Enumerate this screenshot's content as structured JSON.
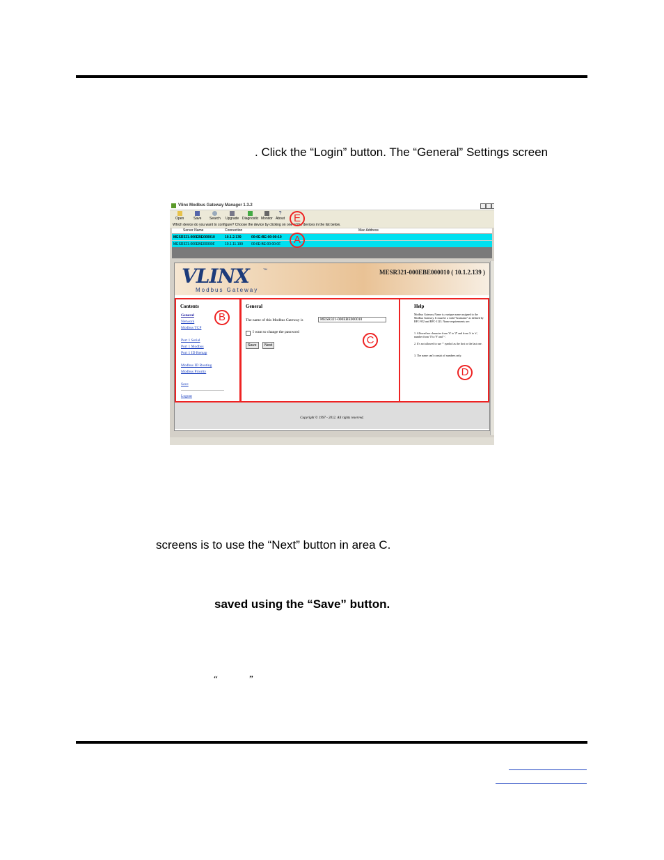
{
  "text": {
    "line1": ". Click the “Login” button. The “General” Settings screen",
    "line2": "screens is to use the “Next” button in area C.",
    "line3": "saved using the “Save” button.",
    "q_open": "“",
    "q_close": "”"
  },
  "screenshot": {
    "window_title": "Vlinx Modbus Gateway Manager 1.3.2",
    "toolbar": [
      "Open",
      "Save",
      "Search",
      "Upgrade",
      "Diagnostic",
      "Monitor",
      "About"
    ],
    "instruction": "Which device do you want to configure? Choose the device by clicking on one of the devices in the list below.",
    "columns": [
      "Server Name",
      "Connection",
      "Mac Address"
    ],
    "rows": [
      {
        "name": "MESR321-000EBE000010",
        "conn": "10.1.2.139",
        "mac": "00:0E:BE:00:00:10"
      },
      {
        "name": "MESR321-000EBE00000F",
        "conn": "10.1.11.199",
        "mac": "00:0E:BE:00:00:0F"
      }
    ],
    "logo": "VLINX",
    "logo_tm": "TM",
    "logo_sub": "Modbus Gateway",
    "device_title": "MESR321-000EBE000010 ( 10.1.2.139 )",
    "contents_title": "Contents",
    "nav": [
      "General",
      "Network",
      "Modbus TCP",
      "Port 1 Serial",
      "Port 1 Modbus",
      "Port 1 ID Remap",
      "Modbus ID Routing",
      "Modbus Priority",
      "Save",
      "Logout"
    ],
    "general_title": "General",
    "name_label": "The name of this Modbus Gateway is",
    "name_value": "MESR321-000EBE000010",
    "password_label": "I want to change the password",
    "save_btn": "Save",
    "next_btn": "Next",
    "help_title": "Help",
    "help_intro": "Modbus Gateway Name is a unique name assigned to the Modbus Gateway. It must be a valid \"hostname\" as defined by RFC-952 and RFC-1123. Name requirements are:",
    "help_1": "1. Allowed are character from 'A' to 'Z' and from 'a' to 'z', number from '0' to '9' and '-'.",
    "help_2": "2. It's not allowed to use '-' symbol as the first or the last one.",
    "help_3": "3. The name can't consist of numbers only.",
    "copyright": "Copyright © 1997 - 2012. All rights reserved.",
    "labels": {
      "A": "A",
      "B": "B",
      "C": "C",
      "D": "D",
      "E": "E"
    }
  },
  "colors": {
    "annotation": "#ee2222",
    "row_highlight": "#00e0f0"
  }
}
